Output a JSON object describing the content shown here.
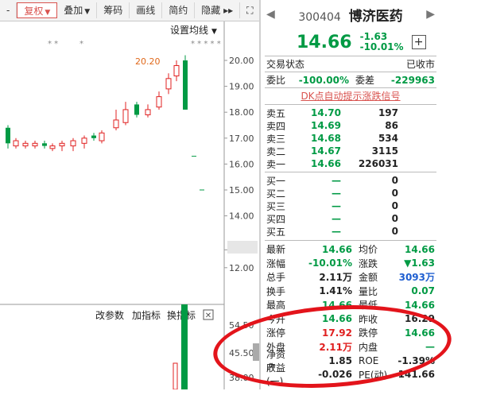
{
  "toolbar": {
    "items": [
      {
        "label": "复权",
        "active": true,
        "dropdown": true
      },
      {
        "label": "叠加",
        "dropdown": true
      },
      {
        "label": "筹码"
      },
      {
        "label": "画线"
      },
      {
        "label": "简约"
      },
      {
        "label": "隐藏"
      }
    ],
    "hide_arrows": "▸▸",
    "expand_icon": "⛶"
  },
  "chart": {
    "settings_label": "设置均线",
    "marker_stars_right": "* * * * *",
    "marker_stars_left": "* *",
    "marker_star_single": "*",
    "peak_label": "20.20",
    "y_ticks": [
      "20.00",
      "19.00",
      "18.00",
      "17.00",
      "16.00",
      "15.00",
      "14.00",
      "12.69",
      "12.00"
    ],
    "bottom_y_ticks": [
      "54.50",
      "45.50",
      "38.00"
    ],
    "indicator_buttons": [
      "改参数",
      "加指标",
      "换指标"
    ],
    "close_icon": "✕"
  },
  "quote": {
    "code": "300404",
    "name": "博济医药",
    "price": "14.66",
    "change": "-1.63",
    "change_pct": "-10.01%",
    "status_label": "交易状态",
    "status_value": "已收市",
    "weibi_label": "委比",
    "weibi_value": "-100.00%",
    "weicha_label": "委差",
    "weicha_value": "-229963",
    "alert_link": "DK点自动提示涨跌信号"
  },
  "sell": [
    {
      "label": "卖五",
      "price": "14.70",
      "vol": "197"
    },
    {
      "label": "卖四",
      "price": "14.69",
      "vol": "86"
    },
    {
      "label": "卖三",
      "price": "14.68",
      "vol": "534"
    },
    {
      "label": "卖二",
      "price": "14.67",
      "vol": "3115"
    },
    {
      "label": "卖一",
      "price": "14.66",
      "vol": "226031"
    }
  ],
  "buy": [
    {
      "label": "买一",
      "price": "—",
      "vol": "0"
    },
    {
      "label": "买二",
      "price": "—",
      "vol": "0"
    },
    {
      "label": "买三",
      "price": "—",
      "vol": "0"
    },
    {
      "label": "买四",
      "price": "—",
      "vol": "0"
    },
    {
      "label": "买五",
      "price": "—",
      "vol": "0"
    }
  ],
  "stats": [
    {
      "l1": "最新",
      "v1": "14.66",
      "c1": "green",
      "l2": "均价",
      "v2": "14.66",
      "c2": "green"
    },
    {
      "l1": "涨幅",
      "v1": "-10.01%",
      "c1": "green",
      "l2": "涨跌",
      "v2": "▼1.63",
      "c2": "green"
    },
    {
      "l1": "总手",
      "v1": "2.11万",
      "c1": "dark",
      "l2": "金额",
      "v2": "3093万",
      "c2": "blue"
    },
    {
      "l1": "换手",
      "v1": "1.41%",
      "c1": "dark",
      "l2": "量比",
      "v2": "0.07",
      "c2": "green"
    },
    {
      "l1": "最高",
      "v1": "14.66",
      "c1": "green",
      "l2": "最低",
      "v2": "14.66",
      "c2": "green"
    },
    {
      "l1": "今开",
      "v1": "14.66",
      "c1": "green",
      "l2": "昨收",
      "v2": "16.29",
      "c2": "dark"
    },
    {
      "l1": "涨停",
      "v1": "17.92",
      "c1": "red",
      "l2": "跌停",
      "v2": "14.66",
      "c2": "green"
    },
    {
      "l1": "外盘",
      "v1": "2.11万",
      "c1": "red",
      "l2": "内盘",
      "v2": "—",
      "c2": "green"
    },
    {
      "l1": "净资产",
      "v1": "1.85",
      "c1": "dark",
      "l2": "ROE",
      "v2": "-1.39%",
      "c2": "dark"
    },
    {
      "l1": "收益(一)",
      "v1": "-0.026",
      "c1": "dark",
      "l2": "PE(动)",
      "v2": "-141.66",
      "c2": "dark"
    }
  ],
  "colors": {
    "up": "#e02020",
    "down": "#009a44",
    "accent": "#d9534f"
  }
}
